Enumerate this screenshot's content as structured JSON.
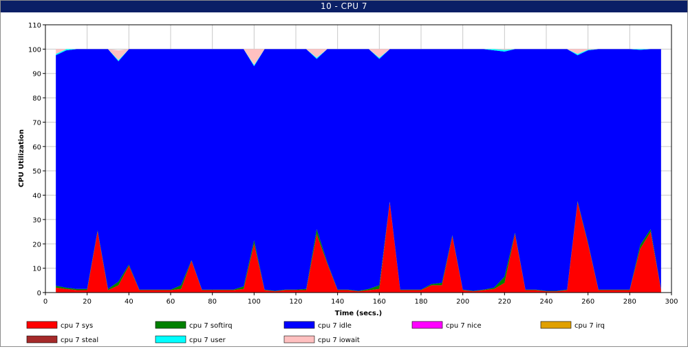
{
  "window": {
    "title": "10 - CPU 7"
  },
  "chart_data": {
    "type": "area",
    "stacked": true,
    "xlabel": "Time (secs.)",
    "ylabel": "CPU Utilization",
    "xlim": [
      0,
      300
    ],
    "ylim": [
      0,
      110
    ],
    "x_ticks": [
      0,
      20,
      40,
      60,
      80,
      100,
      120,
      140,
      160,
      180,
      200,
      220,
      240,
      260,
      280,
      300
    ],
    "y_ticks": [
      0,
      10,
      20,
      30,
      40,
      50,
      60,
      70,
      80,
      90,
      100,
      110
    ],
    "grid": true,
    "legend_position": "bottom",
    "x": [
      5,
      10,
      15,
      20,
      25,
      30,
      35,
      40,
      45,
      50,
      55,
      60,
      65,
      70,
      75,
      80,
      85,
      90,
      95,
      100,
      105,
      110,
      115,
      120,
      125,
      130,
      135,
      140,
      145,
      150,
      155,
      160,
      165,
      170,
      175,
      180,
      185,
      190,
      195,
      200,
      205,
      210,
      215,
      220,
      225,
      230,
      235,
      240,
      245,
      250,
      255,
      260,
      265,
      270,
      275,
      280,
      285,
      290,
      295
    ],
    "series": [
      {
        "name": "cpu 7 sys",
        "color": "#ff0000",
        "values": [
          2,
          1.5,
          1,
          1,
          25,
          1,
          3,
          11,
          1,
          1,
          1,
          1,
          1.5,
          13,
          1,
          1,
          1,
          1,
          1.5,
          20,
          1,
          0.5,
          1,
          1,
          1,
          24,
          12,
          1,
          1,
          0.5,
          1,
          1.5,
          37,
          1,
          1,
          1,
          3,
          3,
          23,
          1,
          0.5,
          1,
          1.5,
          4,
          24,
          1,
          1,
          0.5,
          0.5,
          1,
          37,
          20,
          1,
          1,
          1,
          1,
          18,
          25,
          1
        ]
      },
      {
        "name": "cpu 7 softirq",
        "color": "#008000",
        "values": [
          0.8,
          0.5,
          0.5,
          0.5,
          0.5,
          0.5,
          1.5,
          0.5,
          0.2,
          0.2,
          0.2,
          0.2,
          1.5,
          0.3,
          0.2,
          0.2,
          0.2,
          0.2,
          1,
          1.5,
          0.2,
          0.2,
          0.2,
          0.2,
          0.5,
          2,
          0.5,
          0.2,
          0.2,
          0.2,
          0.5,
          1.5,
          0.3,
          0.2,
          0.2,
          0.2,
          0.5,
          1,
          0.5,
          0.2,
          0.2,
          0.2,
          0.5,
          2.5,
          0.5,
          0.2,
          0.2,
          0.2,
          0.2,
          0.2,
          0.5,
          0.5,
          0.2,
          0.2,
          0.2,
          0.2,
          1.5,
          1,
          0.2
        ]
      },
      {
        "name": "cpu 7 idle",
        "color": "#0000ff",
        "values": [
          94.7,
          97.5,
          98.5,
          98.5,
          74.5,
          98.5,
          90.5,
          88.5,
          98.8,
          98.8,
          98.8,
          98.8,
          97,
          86.7,
          98.8,
          98.8,
          98.8,
          98.8,
          97.5,
          71.5,
          98.8,
          99.3,
          98.8,
          98.8,
          98.5,
          70,
          87.5,
          98.8,
          98.8,
          99.3,
          98.5,
          93,
          62.7,
          98.8,
          98.8,
          98.8,
          96.5,
          96,
          76.5,
          98.8,
          99.3,
          98.8,
          97.5,
          92.5,
          75.5,
          98.8,
          98.8,
          99.3,
          99.3,
          98.8,
          60,
          79,
          98.8,
          98.8,
          98.8,
          98.8,
          80.2,
          74,
          98.8
        ]
      },
      {
        "name": "cpu 7 nice",
        "color": "#ff00ff",
        "values": []
      },
      {
        "name": "cpu 7 irq",
        "color": "#e0a000",
        "values": []
      },
      {
        "name": "cpu 7 steal",
        "color": "#a52a2a",
        "values": []
      },
      {
        "name": "cpu 7 user",
        "color": "#00ffff",
        "values": [
          0.5,
          0.5,
          0,
          0,
          0,
          0,
          0.5,
          0,
          0,
          0,
          0,
          0,
          0,
          0,
          0,
          0,
          0,
          0,
          0,
          0.5,
          0,
          0,
          0,
          0,
          0,
          0.5,
          0,
          0,
          0,
          0,
          0,
          0.5,
          0,
          0,
          0,
          0,
          0,
          0,
          0,
          0,
          0,
          0,
          0.5,
          0.7,
          0,
          0,
          0,
          0,
          0,
          0,
          0.5,
          0.3,
          0,
          0,
          0,
          0,
          0.3,
          0,
          0
        ]
      },
      {
        "name": "cpu 7 iowait",
        "color": "#ffc0c0",
        "values": [
          2,
          0,
          0,
          0,
          0,
          0,
          4,
          0,
          0,
          0,
          0,
          0,
          0,
          0,
          0,
          0,
          0,
          0,
          0,
          6.5,
          0,
          0,
          0,
          0,
          0,
          3.5,
          0,
          0,
          0,
          0,
          0,
          3.5,
          0,
          0,
          0,
          0,
          0,
          0,
          0,
          0,
          0,
          0,
          0,
          0.3,
          0,
          0,
          0,
          0,
          0,
          0,
          2,
          0.2,
          0,
          0,
          0,
          0,
          0,
          0,
          0
        ]
      }
    ]
  }
}
